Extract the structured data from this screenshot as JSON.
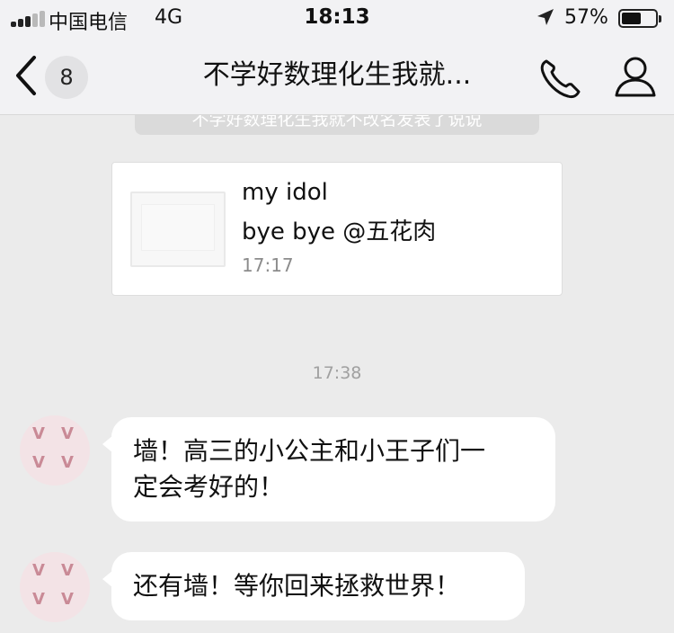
{
  "status_bar": {
    "carrier": "中国电信",
    "network": "4G",
    "time": "18:13",
    "battery_percent": "57%",
    "battery_level": 0.57,
    "signal_bars_on": 3,
    "signal_bars_total": 5
  },
  "nav": {
    "unread_count": "8",
    "title": "不学好数理化生我就...",
    "back_icon": "chevron-left-icon",
    "phone_icon": "phone-icon",
    "profile_icon": "person-icon"
  },
  "chat": {
    "system_notice": "不学好数理化生我就不改名发表了说说",
    "link_card": {
      "title": "my idol",
      "description": "bye bye @五花肉",
      "time": "17:17"
    },
    "time_divider": "17:38",
    "messages": [
      {
        "text_line1": "墙！高三的小公主和小王子们一",
        "text_line2": "定会考好的！"
      },
      {
        "text": "还有墙！等你回来拯救世界！"
      }
    ]
  },
  "colors": {
    "background": "#ebebeb",
    "bar_background": "#f2f2f4",
    "bubble": "#ffffff",
    "muted_text": "#8c8c8c"
  }
}
